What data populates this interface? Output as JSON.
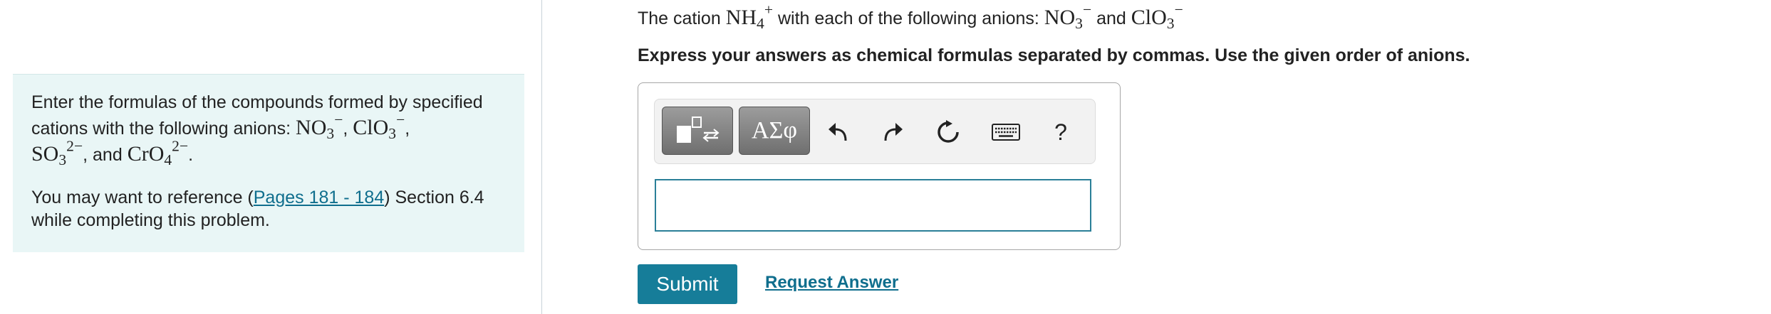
{
  "left_panel": {
    "intro_prefix": "Enter the formulas of the compounds formed by specified cations with the following anions: ",
    "anions": [
      {
        "base": "NO",
        "sub": "3",
        "sup": "−",
        "after": ", "
      },
      {
        "base": "ClO",
        "sub": "3",
        "sup": "−",
        "after": ","
      },
      {
        "base": "SO",
        "sub": "3",
        "sup": "2−",
        "after": ", and "
      },
      {
        "base": "CrO",
        "sub": "4",
        "sup": "2−",
        "after": "."
      }
    ],
    "ref_prefix": "You may want to reference (",
    "ref_link": "Pages 181 - 184",
    "ref_suffix": ") Section 6.4 while completing this problem."
  },
  "question": {
    "prefix": "The cation ",
    "cation": {
      "base": "NH",
      "sub": "4",
      "sup": "+"
    },
    "middle": " with each of the following anions: ",
    "anion1": {
      "base": "NO",
      "sub": "3",
      "sup": "−"
    },
    "joiner": " and ",
    "anion2": {
      "base": "ClO",
      "sub": "3",
      "sup": "−"
    }
  },
  "instruction": "Express your answers as chemical formulas separated by commas. Use the given order of anions.",
  "toolbar": {
    "symbols_label": "ΑΣφ",
    "help_label": "?",
    "icons": [
      "templates-icon",
      "undo-icon",
      "redo-icon",
      "reset-icon",
      "keyboard-icon",
      "help-icon"
    ]
  },
  "answer": {
    "value": ""
  },
  "submit_label": "Submit",
  "request_label": "Request Answer",
  "colors": {
    "panel_bg": "#e9f6f6",
    "accent": "#167d99",
    "link": "#0f6e8d",
    "input_border": "#2a7f98"
  }
}
